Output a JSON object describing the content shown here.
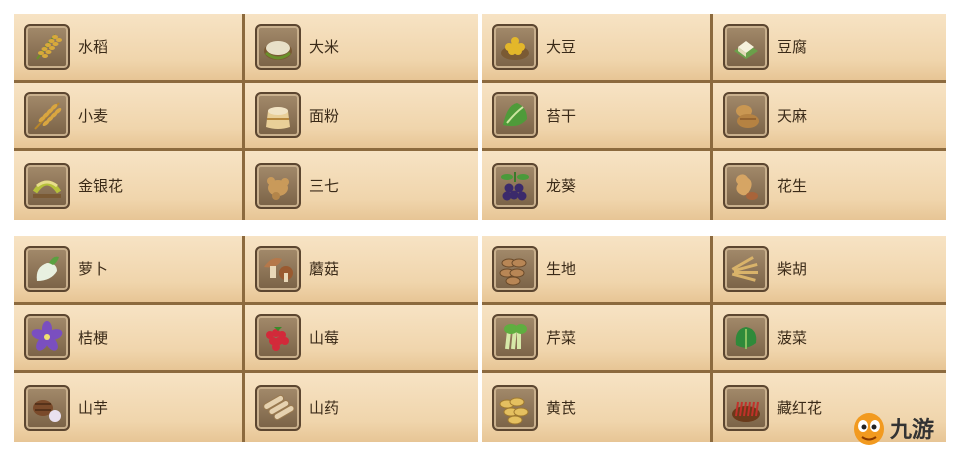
{
  "panels": [
    {
      "items": [
        {
          "label": "水稻",
          "icon": "rice-plant-icon",
          "color": "#d8a93a"
        },
        {
          "label": "大米",
          "icon": "rice-grains-icon",
          "color": "#e8e0c8"
        },
        {
          "label": "小麦",
          "icon": "wheat-icon",
          "color": "#d9a640"
        },
        {
          "label": "面粉",
          "icon": "flour-sack-icon",
          "color": "#f1e3c4"
        },
        {
          "label": "金银花",
          "icon": "honeysuckle-icon",
          "color": "#b6c13a"
        },
        {
          "label": "三七",
          "icon": "sanqi-root-icon",
          "color": "#c99a5a"
        }
      ]
    },
    {
      "items": [
        {
          "label": "大豆",
          "icon": "soybean-icon",
          "color": "#e3b72a"
        },
        {
          "label": "豆腐",
          "icon": "tofu-icon",
          "color": "#f6f1dc"
        },
        {
          "label": "苔干",
          "icon": "celtuce-icon",
          "color": "#4f9b3a"
        },
        {
          "label": "天麻",
          "icon": "gastrodia-icon",
          "color": "#c99752"
        },
        {
          "label": "龙葵",
          "icon": "nightshade-berries-icon",
          "color": "#3b2a6b"
        },
        {
          "label": "花生",
          "icon": "peanut-icon",
          "color": "#d6a564"
        }
      ]
    },
    {
      "items": [
        {
          "label": "萝卜",
          "icon": "radish-icon",
          "color": "#e8f0e0"
        },
        {
          "label": "蘑菇",
          "icon": "mushroom-icon",
          "color": "#b5784a"
        },
        {
          "label": "桔梗",
          "icon": "balloon-flower-icon",
          "color": "#7a4fc0"
        },
        {
          "label": "山莓",
          "icon": "raspberry-icon",
          "color": "#d22a3a"
        },
        {
          "label": "山芋",
          "icon": "yam-taro-icon",
          "color": "#7a4a2a"
        },
        {
          "label": "山药",
          "icon": "chinese-yam-icon",
          "color": "#e6d2b0"
        }
      ]
    },
    {
      "items": [
        {
          "label": "生地",
          "icon": "rehmannia-slices-icon",
          "color": "#b88655"
        },
        {
          "label": "柴胡",
          "icon": "bupleurum-root-icon",
          "color": "#d9b36a"
        },
        {
          "label": "芹菜",
          "icon": "celery-icon",
          "color": "#5fae3f"
        },
        {
          "label": "菠菜",
          "icon": "spinach-icon",
          "color": "#2f8a3a"
        },
        {
          "label": "黄芪",
          "icon": "astragalus-slices-icon",
          "color": "#e5c060"
        },
        {
          "label": "藏红花",
          "icon": "saffron-icon",
          "color": "#c2302a"
        }
      ]
    }
  ],
  "logo": {
    "text": "九游",
    "icon": "jiuyou-mascot-icon",
    "color": "#f29a1f"
  }
}
